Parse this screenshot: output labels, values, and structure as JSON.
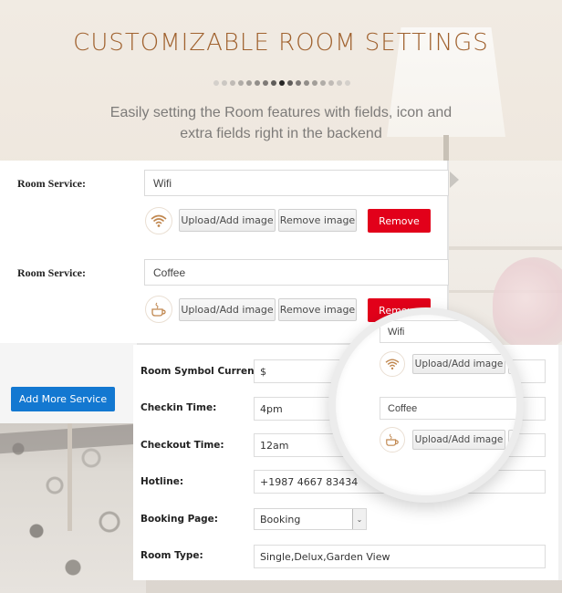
{
  "header": {
    "title": "CUSTOMIZABLE ROOM SETTINGS",
    "subtitle_line1": "Easily setting the Room features with fields, icon and",
    "subtitle_line2": "extra fields right in the backend",
    "dot_count": 17,
    "dot_colors": [
      "#d4d0cb",
      "#cbc7c2",
      "#bfbab5",
      "#b0aca7",
      "#a29e99",
      "#928e8a",
      "#7e7a77",
      "#5f5c5a",
      "#262525",
      "#5f5c5a",
      "#7e7a77",
      "#928e8a",
      "#a29e99",
      "#b0aca7",
      "#bfbab5",
      "#cbc7c2",
      "#d4d0cb"
    ]
  },
  "colors": {
    "title": "#a0622f",
    "remove_button": "#e2001a",
    "add_more_button": "#1378d1",
    "icon_accent": "#c0874f"
  },
  "services_panel": {
    "services": [
      {
        "label": "Room Service:",
        "value": "Wifi",
        "icon": "wifi-icon",
        "upload_label": "Upload/Add image",
        "remove_image_label": "Remove image",
        "remove_label": "Remove"
      },
      {
        "label": "Room Service:",
        "value": "Coffee",
        "icon": "coffee-cup-icon",
        "upload_label": "Upload/Add image",
        "remove_image_label": "Remove image",
        "remove_label": "Remove"
      }
    ],
    "add_more_label": "Add More Service"
  },
  "settings_panel": {
    "fields": [
      {
        "label": "Room Symbol Currency:",
        "value": "$"
      },
      {
        "label": "Checkin Time:",
        "value": "4pm"
      },
      {
        "label": "Checkout Time:",
        "value": "12am"
      },
      {
        "label": "Hotline:",
        "value": "+1987 4667 83434"
      },
      {
        "label": "Booking Page:",
        "value": "Booking",
        "type": "select"
      },
      {
        "label": "Room Type:",
        "value": "Single,Delux,Garden View"
      }
    ]
  },
  "magnifier": {
    "services": [
      {
        "value": "Wifi",
        "icon": "wifi-icon",
        "upload_label": "Upload/Add image"
      },
      {
        "value": "Coffee",
        "icon": "coffee-cup-icon",
        "upload_label": "Upload/Add image"
      }
    ]
  }
}
